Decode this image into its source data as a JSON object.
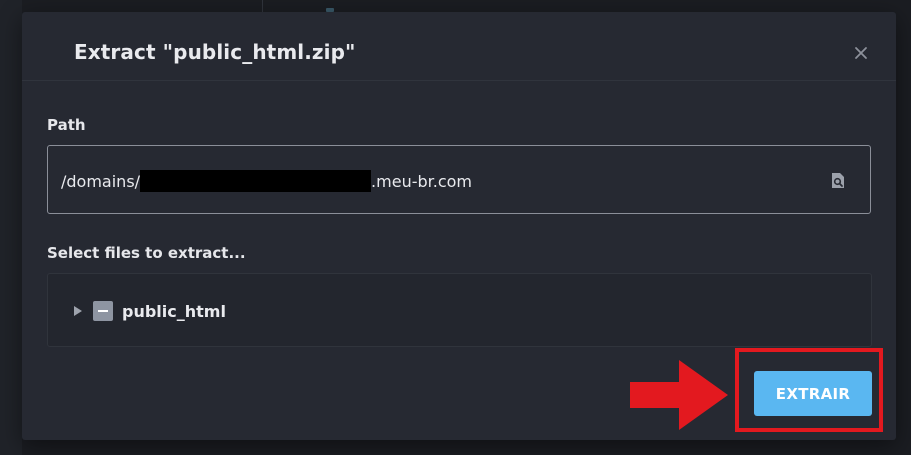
{
  "dialog": {
    "title": "Extract \"public_html.zip\"",
    "close_icon": "close-icon"
  },
  "path": {
    "label": "Path",
    "value_prefix": "/domains/",
    "value_suffix": ".meu-br.com",
    "browse_icon": "file-search-icon"
  },
  "files": {
    "label": "Select files to extract...",
    "tree": [
      {
        "name": "public_html",
        "expanded": false,
        "checkbox_state": "indeterminate"
      }
    ]
  },
  "actions": {
    "extract_label": "EXTRAIR"
  },
  "annotation": {
    "arrow_icon": "right-arrow-icon",
    "color": "#e3191f"
  },
  "colors": {
    "dialog_bg": "#262932",
    "page_bg": "#1b1d22",
    "primary_button": "#5ab7f1",
    "highlight": "#e3191f"
  }
}
